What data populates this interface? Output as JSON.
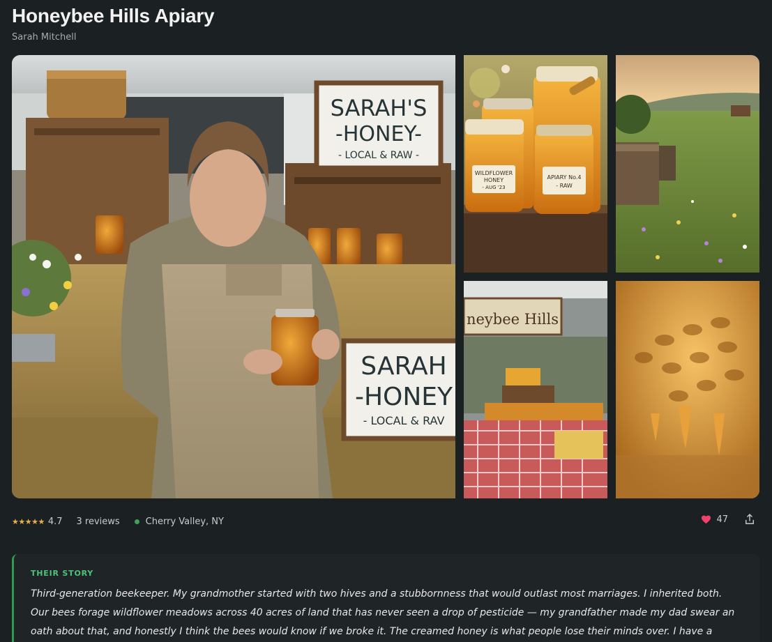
{
  "listing": {
    "title": "Honeybee Hills Apiary",
    "owner": "Sarah Mitchell"
  },
  "gallery": {
    "main_sign": [
      "SARAH'S",
      "-HONEY-",
      "- LOCAL & RAW -"
    ],
    "main_sign2": [
      "SARAH",
      "-HONEY",
      "- LOCAL & RAV"
    ],
    "jar_labels": [
      [
        "WILDFLOWER",
        "HONEY",
        "- AUG '23"
      ],
      [
        "APIARY No.4",
        "- RAW"
      ]
    ],
    "market_banner": "neybee Hills"
  },
  "meta": {
    "stars": "★★★★★",
    "rating": "4.7",
    "reviews": "3 reviews",
    "location": "Cherry Valley, NY",
    "likes": "47"
  },
  "story": {
    "label": "THEIR STORY",
    "text": "Third-generation beekeeper. My grandmother started with two hives and a stubbornness that would outlast most marriages. I inherited both. Our bees forage wildflower meadows across 40 acres of land that has never seen a drop of pesticide — my grandfather made my dad swear an oath about that, and honestly I think the bees would know if we broke it. The creamed honey is what people lose their minds over. I have a customer who"
  },
  "colors": {
    "background": "#1b2022",
    "accent_green": "#4fc27a",
    "star": "#e8b04a",
    "heart": "#f0436a"
  },
  "icons": {
    "like": "heart-icon",
    "share": "share-icon",
    "location": "location-dot-icon"
  }
}
